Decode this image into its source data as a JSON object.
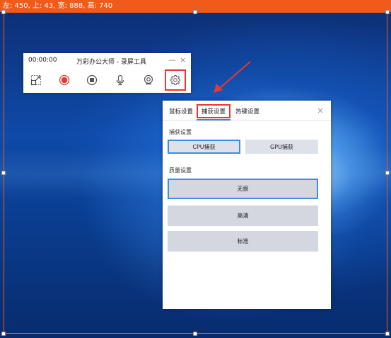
{
  "status_bar": {
    "text": "左: 450, 上: 43, 宽: 888, 高: 740"
  },
  "toolbar": {
    "time": "00:00:00",
    "title": "万彩办公大师 - 录屏工具",
    "minimize": "—",
    "close": "×",
    "icons": [
      "select-region-icon",
      "record-icon",
      "stop-icon",
      "microphone-icon",
      "webcam-icon",
      "settings-icon"
    ],
    "record_color": "#e53935"
  },
  "settings_panel": {
    "tabs": [
      "鼠标设置",
      "捕获设置",
      "热键设置"
    ],
    "active_tab": "捕获设置",
    "close": "×",
    "capture_section": "捕获设置",
    "capture_options": [
      "CPU捕获",
      "GPU捕获"
    ],
    "capture_selected": "CPU捕获",
    "quality_section": "质量设置",
    "quality_options": [
      "无损",
      "高清",
      "标准"
    ],
    "quality_selected": "无损"
  },
  "colors": {
    "highlight": "#e53935",
    "accent": "#2b8de8",
    "frame": "#f05a1a"
  }
}
